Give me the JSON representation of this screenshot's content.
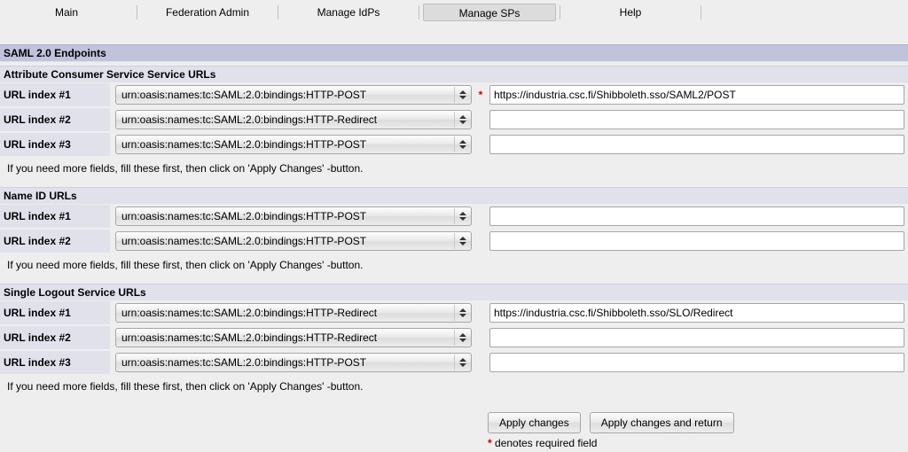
{
  "tabs": {
    "main": "Main",
    "fed_admin": "Federation Admin",
    "manage_idps": "Manage IdPs",
    "manage_sps": "Manage SPs",
    "help": "Help",
    "active": "manage_sps"
  },
  "sections": {
    "endpoints_header": "SAML 2.0 Endpoints",
    "acs_header": "Attribute Consumer Service Service URLs",
    "nameid_header": "Name ID URLs",
    "slo_header": "Single Logout Service URLs"
  },
  "labels": {
    "url_index_1": "URL index #1",
    "url_index_2": "URL index #2",
    "url_index_3": "URL index #3",
    "hint": "If you need more fields, fill these first, then click on 'Apply Changes' -button."
  },
  "bindings": {
    "post": "urn:oasis:names:tc:SAML:2.0:bindings:HTTP-POST",
    "redirect": "urn:oasis:names:tc:SAML:2.0:bindings:HTTP-Redirect"
  },
  "acs": {
    "r1_binding": "urn:oasis:names:tc:SAML:2.0:bindings:HTTP-POST",
    "r1_url": "https://industria.csc.fi/Shibboleth.sso/SAML2/POST",
    "r2_binding": "urn:oasis:names:tc:SAML:2.0:bindings:HTTP-Redirect",
    "r2_url": "",
    "r3_binding": "urn:oasis:names:tc:SAML:2.0:bindings:HTTP-POST",
    "r3_url": ""
  },
  "nameid": {
    "r1_binding": "urn:oasis:names:tc:SAML:2.0:bindings:HTTP-POST",
    "r1_url": "",
    "r2_binding": "urn:oasis:names:tc:SAML:2.0:bindings:HTTP-POST",
    "r2_url": ""
  },
  "slo": {
    "r1_binding": "urn:oasis:names:tc:SAML:2.0:bindings:HTTP-Redirect",
    "r1_url": "https://industria.csc.fi/Shibboleth.sso/SLO/Redirect",
    "r2_binding": "urn:oasis:names:tc:SAML:2.0:bindings:HTTP-Redirect",
    "r2_url": "",
    "r3_binding": "urn:oasis:names:tc:SAML:2.0:bindings:HTTP-POST",
    "r3_url": ""
  },
  "buttons": {
    "apply": "Apply changes",
    "apply_return": "Apply changes and return"
  },
  "footnote": "denotes required field",
  "star": "*"
}
